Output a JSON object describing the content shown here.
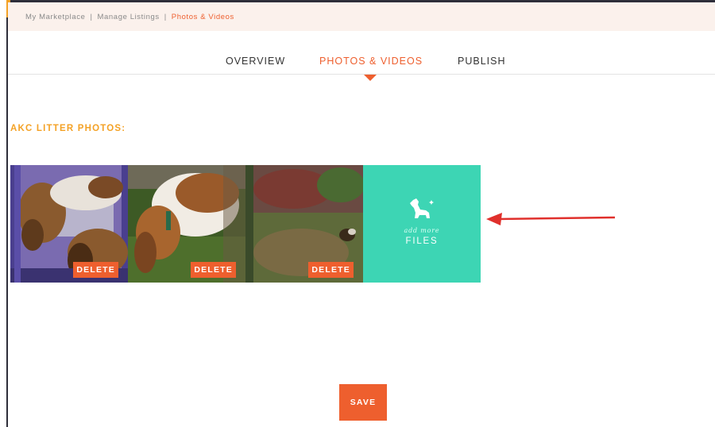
{
  "breadcrumb": {
    "items": [
      "My Marketplace",
      "Manage Listings",
      "Photos & Videos"
    ],
    "separator": "|"
  },
  "tabs": {
    "overview": "OVERVIEW",
    "photos": "PHOTOS & VIDEOS",
    "publish": "PUBLISH"
  },
  "section": {
    "title": "AKC LITTER PHOTOS:"
  },
  "photos": [
    {
      "delete_label": "DELETE"
    },
    {
      "delete_label": "DELETE"
    },
    {
      "delete_label": "DELETE"
    }
  ],
  "add_tile": {
    "small": "add more",
    "big": "FILES",
    "icon": "dog-icon"
  },
  "save": {
    "label": "SAVE"
  },
  "colors": {
    "accent": "#ee5f2e",
    "title": "#f4a226",
    "add_tile": "#3dd5b4",
    "breadcrumb_bg": "#fbf1ec",
    "arrow": "#e0302c"
  }
}
